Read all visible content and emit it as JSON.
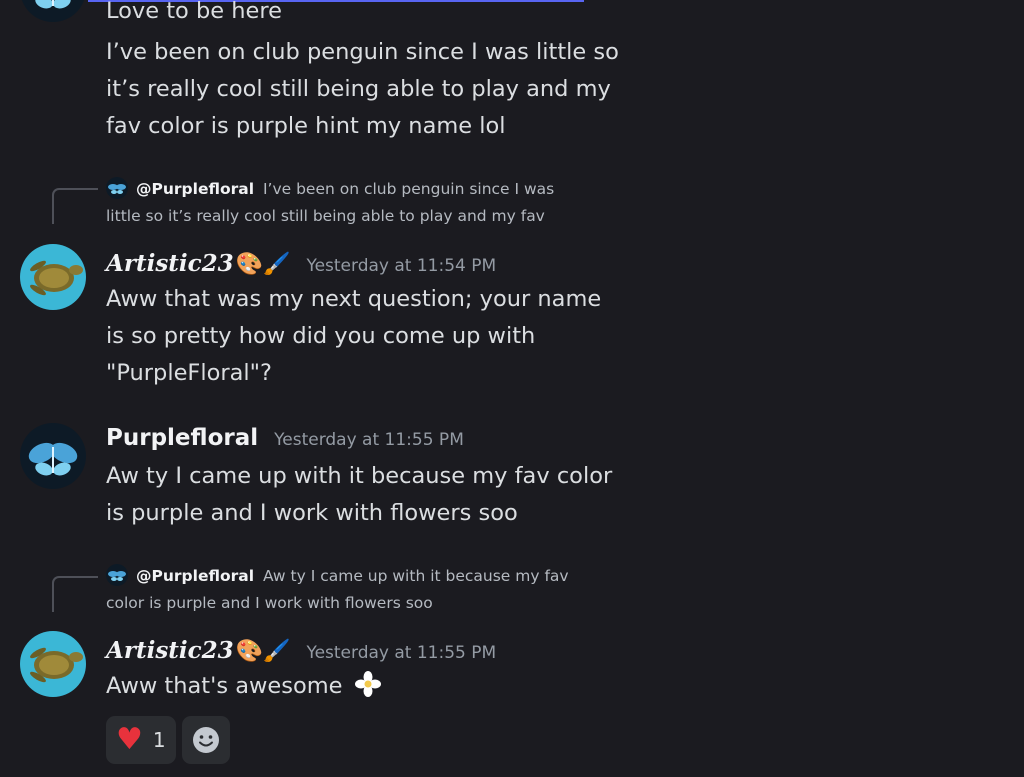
{
  "colors": {
    "background": "#1b1b20",
    "accent": "#5865f2",
    "heart": "#e8323c",
    "timestamp": "#949ba4"
  },
  "messages": [
    {
      "type": "continuation",
      "author": "Purplefloral",
      "lines": [
        "Love to be here",
        "I’ve been on club penguin since I was little so\nit’s really cool still being able to play and my\nfav color is purple hint my name lol"
      ]
    },
    {
      "type": "reply",
      "reply_to": {
        "mention": "@Purplefloral",
        "excerpt": "I’ve been on club penguin since I was",
        "excerpt_line2": "little so it’s really cool still being able to play and my fav"
      },
      "author": "Artistic23",
      "author_emoji": "🎨🖌️",
      "timestamp": "Yesterday at 11:54 PM",
      "text": "Aww that was my next question; your name\nis so pretty how did you come up with\n\"PurpleFloral\"?",
      "avatar_icon": "sea-turtle-avatar"
    },
    {
      "type": "message",
      "author": "Purplefloral",
      "timestamp": "Yesterday at 11:55 PM",
      "text": "Aw ty I came up with it because my fav color\nis purple and I work with flowers soo",
      "avatar_icon": "butterfly-avatar"
    },
    {
      "type": "reply",
      "reply_to": {
        "mention": "@Purplefloral",
        "excerpt": "Aw ty I came up with it because my fav",
        "excerpt_line2": "color is purple and I work with flowers soo"
      },
      "author": "Artistic23",
      "author_emoji": "🎨🖌️",
      "timestamp": "Yesterday at 11:55 PM",
      "text": "Aww that's awesome",
      "text_emoji": "white-flower-emoji",
      "avatar_icon": "sea-turtle-avatar",
      "reactions": [
        {
          "icon": "heart-icon",
          "count": "1"
        }
      ],
      "add_reaction_icon": "smiley-add-reaction-icon"
    }
  ]
}
